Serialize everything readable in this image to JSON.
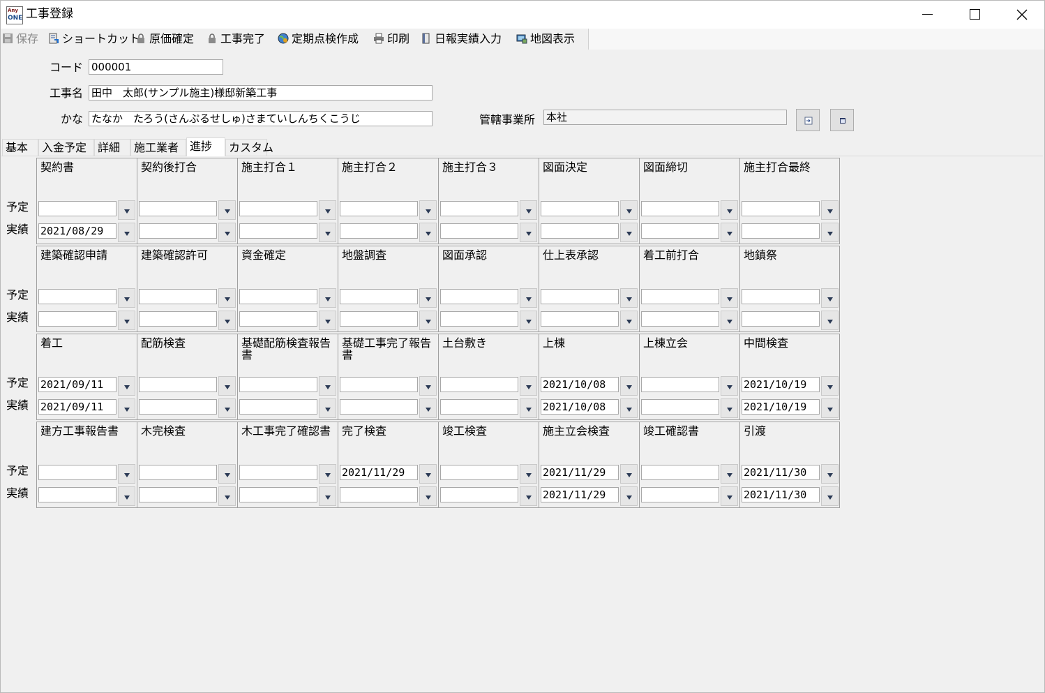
{
  "window": {
    "title": "工事登録",
    "app_icon_top": "Any",
    "app_icon_bottom": "ONE"
  },
  "toolbar": {
    "items": [
      {
        "label": "保存",
        "icon": "save-icon",
        "enabled": false
      },
      {
        "label": "ショートカット",
        "icon": "shortcut-icon",
        "enabled": true
      },
      {
        "label": "原価確定",
        "icon": "lock-icon",
        "enabled": true
      },
      {
        "label": "工事完了",
        "icon": "lock-icon",
        "enabled": true
      },
      {
        "label": "定期点検作成",
        "icon": "globe-icon",
        "enabled": true
      },
      {
        "label": "印刷",
        "icon": "printer-icon",
        "enabled": true
      },
      {
        "label": "日報実績入力",
        "icon": "book-icon",
        "enabled": true
      },
      {
        "label": "地図表示",
        "icon": "map-icon",
        "enabled": true
      }
    ]
  },
  "form": {
    "code_label": "コード",
    "code_value": "000001",
    "name_label": "工事名",
    "name_value": "田中　太郎(サンプル施主)様邸新築工事",
    "kana_label": "かな",
    "kana_value": "たなか　たろう(さんぷるせしゅ)さまていしんちくこうじ",
    "office_label": "管轄事業所",
    "office_value": "本社"
  },
  "tabs": [
    {
      "label": "基本",
      "active": false
    },
    {
      "label": "入金予定",
      "active": false
    },
    {
      "label": "詳細",
      "active": false
    },
    {
      "label": "施工業者",
      "active": false
    },
    {
      "label": "進捗",
      "active": true
    },
    {
      "label": "カスタム",
      "active": false
    }
  ],
  "progress": {
    "plan_label": "予定",
    "actual_label": "実績",
    "rows": [
      {
        "items": [
          {
            "name": "契約書",
            "plan": "",
            "actual": "2021/08/29"
          },
          {
            "name": "契約後打合",
            "plan": "",
            "actual": ""
          },
          {
            "name": "施主打合１",
            "plan": "",
            "actual": ""
          },
          {
            "name": "施主打合２",
            "plan": "",
            "actual": ""
          },
          {
            "name": "施主打合３",
            "plan": "",
            "actual": ""
          },
          {
            "name": "図面決定",
            "plan": "",
            "actual": ""
          },
          {
            "name": "図面締切",
            "plan": "",
            "actual": ""
          },
          {
            "name": "施主打合最終",
            "plan": "",
            "actual": ""
          }
        ]
      },
      {
        "items": [
          {
            "name": "建築確認申請",
            "plan": "",
            "actual": ""
          },
          {
            "name": "建築確認許可",
            "plan": "",
            "actual": ""
          },
          {
            "name": "資金確定",
            "plan": "",
            "actual": ""
          },
          {
            "name": "地盤調査",
            "plan": "",
            "actual": ""
          },
          {
            "name": "図面承認",
            "plan": "",
            "actual": ""
          },
          {
            "name": "仕上表承認",
            "plan": "",
            "actual": ""
          },
          {
            "name": "着工前打合",
            "plan": "",
            "actual": ""
          },
          {
            "name": "地鎮祭",
            "plan": "",
            "actual": ""
          }
        ]
      },
      {
        "items": [
          {
            "name": "着工",
            "plan": "2021/09/11",
            "actual": "2021/09/11"
          },
          {
            "name": "配筋検査",
            "plan": "",
            "actual": ""
          },
          {
            "name": "基礎配筋検査報告書",
            "plan": "",
            "actual": ""
          },
          {
            "name": "基礎工事完了報告書",
            "plan": "",
            "actual": ""
          },
          {
            "name": "土台敷き",
            "plan": "",
            "actual": ""
          },
          {
            "name": "上棟",
            "plan": "2021/10/08",
            "actual": "2021/10/08"
          },
          {
            "name": "上棟立会",
            "plan": "",
            "actual": ""
          },
          {
            "name": "中間検査",
            "plan": "2021/10/19",
            "actual": "2021/10/19"
          }
        ]
      },
      {
        "items": [
          {
            "name": "建方工事報告書",
            "plan": "",
            "actual": ""
          },
          {
            "name": "木完検査",
            "plan": "",
            "actual": ""
          },
          {
            "name": "木工事完了確認書",
            "plan": "",
            "actual": ""
          },
          {
            "name": "完了検査",
            "plan": "2021/11/29",
            "actual": ""
          },
          {
            "name": "竣工検査",
            "plan": "",
            "actual": ""
          },
          {
            "name": "施主立会検査",
            "plan": "2021/11/29",
            "actual": "2021/11/29"
          },
          {
            "name": "竣工確認書",
            "plan": "",
            "actual": ""
          },
          {
            "name": "引渡",
            "plan": "2021/11/30",
            "actual": "2021/11/30"
          }
        ]
      }
    ]
  }
}
